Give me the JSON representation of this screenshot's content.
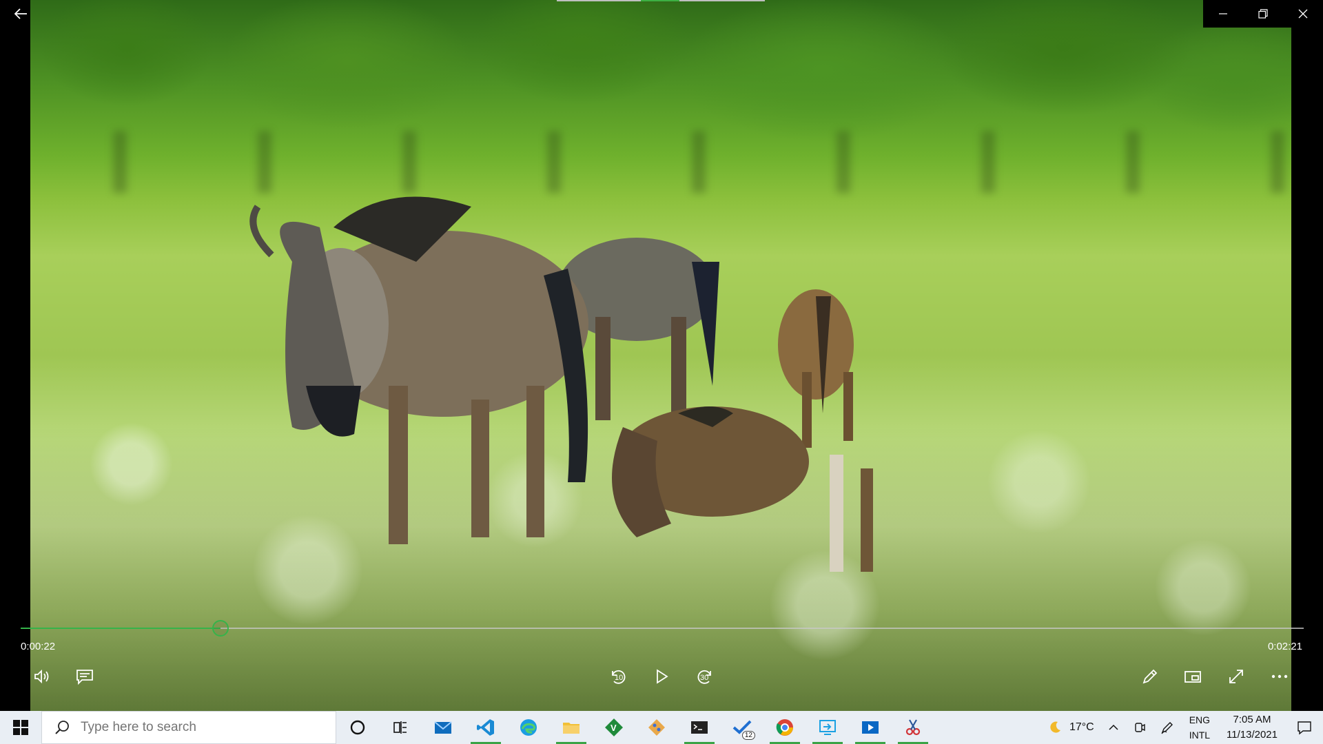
{
  "player": {
    "current_time": "0:00:22",
    "total_time": "0:02:21",
    "progress": 0.156,
    "skip_back_seconds": "10",
    "skip_forward_seconds": "30"
  },
  "taskbar": {
    "search_placeholder": "Type here to search",
    "todo_badge": "12",
    "weather_temp": "17°C",
    "language_primary": "ENG",
    "language_secondary": "INTL",
    "time": "7:05 AM",
    "date": "11/13/2021"
  },
  "colors": {
    "accent": "#35b44a",
    "taskbar_bg": "#e9eef4"
  }
}
